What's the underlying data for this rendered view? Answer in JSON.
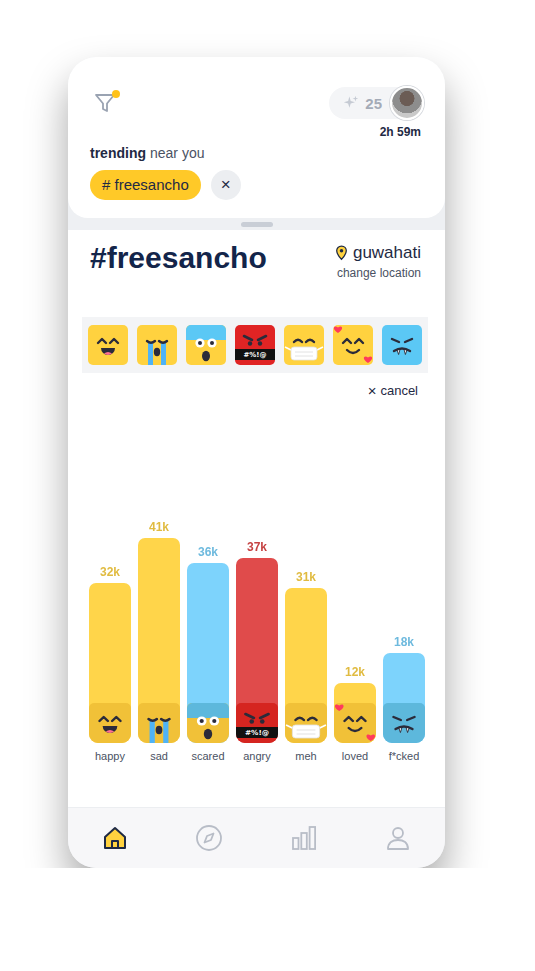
{
  "filter": {
    "active": true
  },
  "header": {
    "points": "25",
    "timer": "2h 59m"
  },
  "trending": {
    "label": "trending",
    "suffix": "near you",
    "tag": "# freesancho",
    "clear": "×"
  },
  "topic": {
    "title": "#freesancho",
    "location": "guwahati",
    "change_location": "change location"
  },
  "moods": [
    {
      "kind": "happy",
      "face_text": ""
    },
    {
      "kind": "sad",
      "face_text": ""
    },
    {
      "kind": "scared",
      "face_text": ""
    },
    {
      "kind": "angry",
      "face_text": "#%!@"
    },
    {
      "kind": "meh",
      "face_text": ""
    },
    {
      "kind": "loved",
      "face_text": ""
    },
    {
      "kind": "fcked",
      "face_text": ""
    }
  ],
  "cancel": {
    "icon": "×",
    "label": "cancel"
  },
  "chart": {
    "values": [
      32,
      41,
      36,
      37,
      31,
      12,
      18
    ],
    "bars": [
      {
        "kind": "happy",
        "label": "happy",
        "value_label": "32k",
        "color": "#FFD54A",
        "face_text": ""
      },
      {
        "kind": "sad",
        "label": "sad",
        "value_label": "41k",
        "color": "#FFD54A",
        "face_text": ""
      },
      {
        "kind": "scared",
        "label": "scared",
        "value_label": "36k",
        "color": "#7DD3FC",
        "face_text": ""
      },
      {
        "kind": "angry",
        "label": "angry",
        "value_label": "37k",
        "color": "#E04B4B",
        "face_text": "#%!@"
      },
      {
        "kind": "meh",
        "label": "meh",
        "value_label": "31k",
        "color": "#FFD54A",
        "face_text": ""
      },
      {
        "kind": "loved",
        "label": "loved",
        "value_label": "12k",
        "color": "#FFD54A",
        "face_text": ""
      },
      {
        "kind": "fcked",
        "label": "f*cked",
        "value_label": "18k",
        "color": "#7DD3FC",
        "face_text": ""
      }
    ]
  },
  "nav": [
    {
      "kind": "home",
      "selected": true
    },
    {
      "kind": "explore",
      "selected": false
    },
    {
      "kind": "stats",
      "selected": false
    },
    {
      "kind": "profile",
      "selected": false
    }
  ]
}
